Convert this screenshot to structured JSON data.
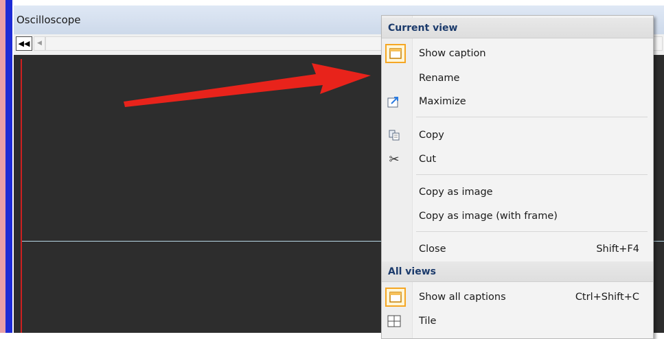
{
  "window": {
    "title": "Oscilloscope",
    "scroll_left_label": "◀◀",
    "scroll_step_label": "◀"
  },
  "menu": {
    "sections": [
      {
        "header": "Current view",
        "items": [
          {
            "label": "Show caption",
            "icon": "show-caption-icon"
          },
          {
            "label": "Rename",
            "icon": ""
          },
          {
            "label": "Maximize",
            "icon": "maximize-icon"
          },
          {
            "label": "Copy",
            "icon": "copy-icon"
          },
          {
            "label": "Cut",
            "icon": "cut-icon"
          },
          {
            "label": "Copy as image",
            "icon": ""
          },
          {
            "label": "Copy as image (with frame)",
            "icon": ""
          },
          {
            "label": "Close",
            "shortcut": "Shift+F4",
            "icon": ""
          }
        ]
      },
      {
        "header": "All views",
        "items": [
          {
            "label": "Show all captions",
            "shortcut": "Ctrl+Shift+C",
            "icon": "show-all-captions-icon"
          },
          {
            "label": "Tile",
            "icon": "tile-icon"
          }
        ]
      }
    ]
  },
  "colors": {
    "scope_background": "#2d2d2d",
    "scope_trace": "#b9d9e6",
    "arrow": "#e8231b",
    "menu_header_text": "#1b3a6b",
    "icon_highlight_border": "#f5a623"
  }
}
